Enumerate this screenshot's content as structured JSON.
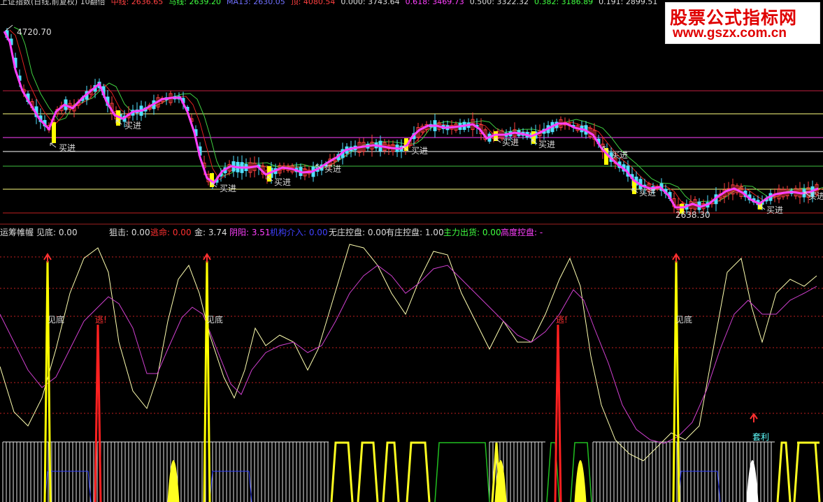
{
  "top_bar": {
    "items": [
      {
        "text": "上证指数(日线,前复权) 10翻倍",
        "color": "#d0d0d0"
      },
      {
        "text": "中线: 2636.65",
        "color": "#ff4040"
      },
      {
        "text": "马线: 2639.20",
        "color": "#40ff40"
      },
      {
        "text": "MA13: 2630.05",
        "color": "#7070ff"
      },
      {
        "text": "顶: 4080.54",
        "color": "#ff4040"
      },
      {
        "text": "0.000: 3743.64",
        "color": "#dddddd"
      },
      {
        "text": "0.618: 3469.73",
        "color": "#ff40ff"
      },
      {
        "text": "0.500: 3322.32",
        "color": "#dddddd"
      },
      {
        "text": "0.382: 3186.89",
        "color": "#40ff40"
      },
      {
        "text": "0.191: 2899.51",
        "color": "#dddddd"
      }
    ]
  },
  "watermark": {
    "line1": "股票公式指标网",
    "line2": "www.gszx.com.cn"
  },
  "price_chart": {
    "high_label": "4720.70",
    "low_label": "2638.30",
    "buy_label": "买进",
    "colors": {
      "up": "#ff4040",
      "down": "#50e0ff",
      "signal": "#ffff00",
      "ma_main": "#ff40ff",
      "ma_slow": "#40d040",
      "ma_red": "#e02020"
    }
  },
  "indicator_header": {
    "items": [
      {
        "text": "运筹帷幄",
        "color": "#dddddd"
      },
      {
        "text": "见底: 0.00",
        "color": "#dddddd"
      },
      {
        "text": "狙击: 0.00",
        "color": "#dddddd"
      },
      {
        "text": "逃命: 0.00",
        "color": "#ff3030"
      },
      {
        "text": "金: 3.74",
        "color": "#dddddd"
      },
      {
        "text": "阴阳: 3.51",
        "color": "#ff40ff"
      },
      {
        "text": "机构介入: 0.00",
        "color": "#4040ff"
      },
      {
        "text": "无庄控盘: 0.00",
        "color": "#dddddd"
      },
      {
        "text": "有庄控盘: 1.00",
        "color": "#dddddd"
      },
      {
        "text": "主力出货: 0.00",
        "color": "#40ff40"
      },
      {
        "text": "高度控盘: -",
        "color": "#ff40ff"
      }
    ]
  },
  "indicator_chart": {
    "bottom_label": "见底",
    "escape_label": "逃!",
    "arbitrage_label": "套利",
    "colors": {
      "white_line": "#ffffb0",
      "magenta_line": "#d040d0",
      "spike_yellow": "#ffff00",
      "spike_red": "#ff2020",
      "green": "#20c020"
    }
  }
}
